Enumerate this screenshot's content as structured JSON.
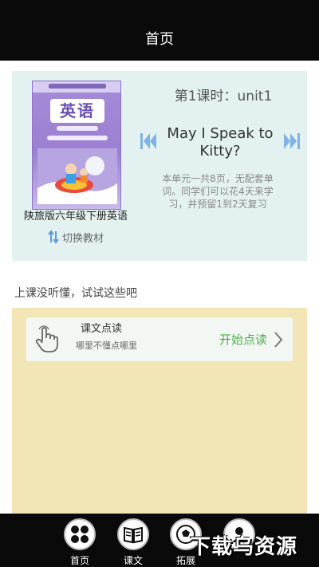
{
  "header": {
    "title": "首页"
  },
  "book": {
    "cover_title": "英语",
    "name": "陕旅版六年级下册英语",
    "switch_label": "切换教材"
  },
  "lesson": {
    "heading": "第1课时：unit1",
    "title": "May I Speak to Kitty?",
    "description": "本单元一共8页，无配套单词。同学们可以花4天来学习，并预留1到2天复习"
  },
  "prompt": "上课没听懂，试试这些吧",
  "read_card": {
    "title": "课文点读",
    "subtitle": "哪里不懂点哪里",
    "action_label": "开始点读"
  },
  "tabs": [
    {
      "label": "首页",
      "icon": "grid-icon"
    },
    {
      "label": "课文",
      "icon": "book-icon"
    },
    {
      "label": "拓展",
      "icon": "soccer-icon"
    },
    {
      "label": "",
      "icon": "avatar-icon"
    }
  ],
  "watermark": "下载乌资源",
  "colors": {
    "accent_green": "#4cae4c",
    "lesson_bg": "#e3f2f0",
    "practice_bg": "#f2e5b6",
    "nav_blue": "#7fb3e8"
  }
}
